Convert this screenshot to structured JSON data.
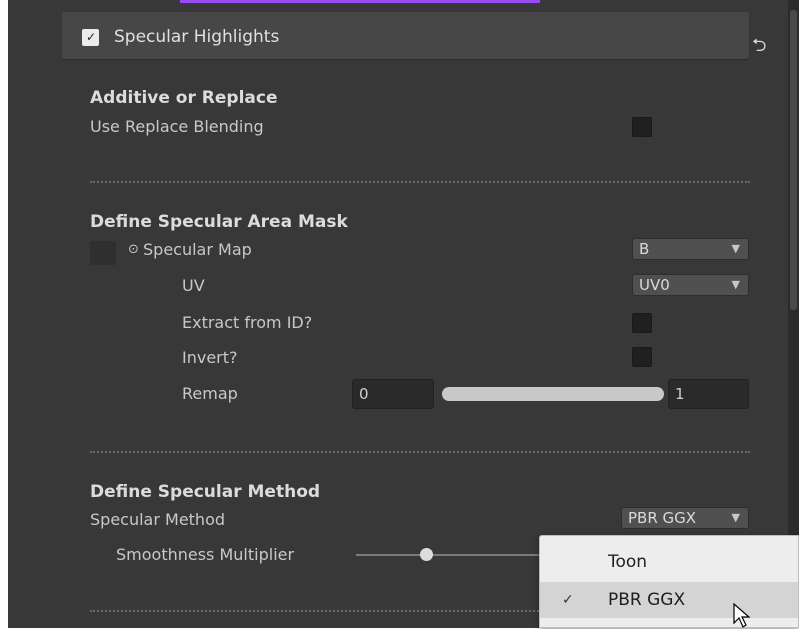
{
  "header": {
    "title": "Specular Highlights",
    "checked": true
  },
  "additive": {
    "heading": "Additive or Replace",
    "replace_label": "Use Replace Blending"
  },
  "mask": {
    "heading": "Define Specular Area Mask",
    "map_label": "Specular Map",
    "map_channel": "B",
    "uv_label": "UV",
    "uv_value": "UV0",
    "extract_label": "Extract from ID?",
    "invert_label": "Invert?",
    "remap_label": "Remap",
    "remap_min": "0",
    "remap_max": "1"
  },
  "method": {
    "heading": "Define Specular Method",
    "method_label": "Specular Method",
    "method_value": "PBR GGX",
    "smoothness_label": "Smoothness Multiplier"
  },
  "popup": {
    "items": [
      {
        "label": "Toon",
        "selected": false
      },
      {
        "label": "PBR GGX",
        "selected": true
      }
    ],
    "check_glyph": "✓"
  },
  "icons": {
    "reset": "reset-icon",
    "dropdown": "chevron-down-icon",
    "map_dot": "circle-dot-icon"
  },
  "colors": {
    "panel": "#383838",
    "header": "#474747",
    "popup": "#ededed",
    "accent": "#9a4cf2"
  }
}
